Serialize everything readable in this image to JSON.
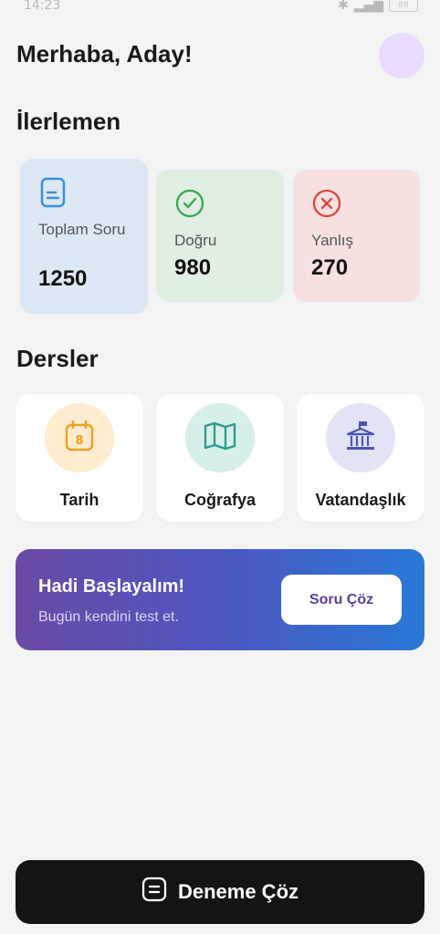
{
  "status_bar": {
    "time": "14:23",
    "battery": "88"
  },
  "header": {
    "greeting": "Merhaba, Aday!"
  },
  "progress": {
    "title": "İlerlemen",
    "cards": [
      {
        "icon": "document-icon",
        "label": "Toplam Soru",
        "value": "1250",
        "color": "#dde8f5",
        "accent": "#3a8fd8"
      },
      {
        "icon": "check-circle-icon",
        "label": "Doğru",
        "value": "980",
        "color": "#e1eee2",
        "accent": "#39a853"
      },
      {
        "icon": "x-circle-icon",
        "label": "Yanlış",
        "value": "270",
        "color": "#f6e1e0",
        "accent": "#e0463e"
      }
    ]
  },
  "courses": {
    "title": "Dersler",
    "items": [
      {
        "label": "Tarih",
        "icon": "calendar-icon",
        "circle_color": "#fdecd0",
        "accent": "#f0a020"
      },
      {
        "label": "Coğrafya",
        "icon": "map-icon",
        "circle_color": "#d6efea",
        "accent": "#2a9a8c"
      },
      {
        "label": "Vatandaşlık",
        "icon": "government-building-icon",
        "circle_color": "#e2e3f5",
        "accent": "#4b55b0"
      }
    ]
  },
  "banner": {
    "title": "Hadi Başlayalım!",
    "subtitle": "Bugün kendini test et.",
    "button_label": "Soru Çöz"
  },
  "bottom_action": {
    "label": "Deneme Çöz",
    "icon": "exam-icon"
  }
}
